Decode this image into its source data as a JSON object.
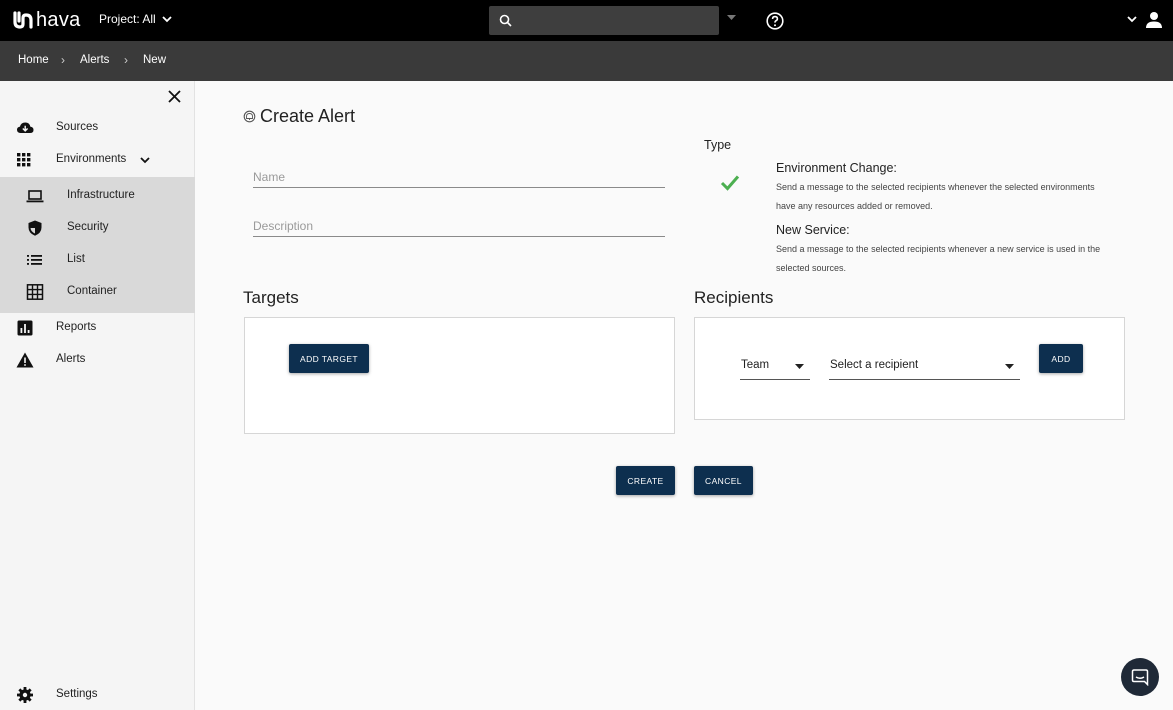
{
  "app": {
    "logo_text": "hava",
    "project_label": "Project: All"
  },
  "search": {
    "placeholder": ""
  },
  "breadcrumb": [
    "Home",
    "Alerts",
    "New"
  ],
  "sidebar": {
    "items": [
      {
        "label": "Sources",
        "icon": "cloud-download-icon"
      },
      {
        "label": "Environments",
        "icon": "grid-icon"
      }
    ],
    "sub_items": [
      {
        "label": "Infrastructure",
        "icon": "laptop-icon"
      },
      {
        "label": "Security",
        "icon": "shield-icon"
      },
      {
        "label": "List",
        "icon": "list-icon"
      },
      {
        "label": "Container",
        "icon": "table-grid-icon"
      }
    ],
    "lower_items": [
      {
        "label": "Reports",
        "icon": "bar-chart-icon"
      },
      {
        "label": "Alerts",
        "icon": "warning-icon"
      }
    ],
    "settings_label": "Settings"
  },
  "form": {
    "title": "Create Alert",
    "name_placeholder": "Name",
    "description_placeholder": "Description",
    "type_label": "Type",
    "types": [
      {
        "title": "Environment Change:",
        "desc": "Send a message to the selected recipients whenever the selected environments have any resources added or removed.",
        "selected": true
      },
      {
        "title": "New Service:",
        "desc": "Send a message to the selected recipients whenever a new service is used in the selected sources.",
        "selected": false
      }
    ],
    "targets_heading": "Targets",
    "add_target_label": "ADD TARGET",
    "recipients_heading": "Recipients",
    "recipient_kind": "Team",
    "recipient_placeholder": "Select a recipient",
    "add_label": "ADD",
    "create_label": "CREATE",
    "cancel_label": "CANCEL"
  },
  "colors": {
    "topbar": "#000000",
    "crumbbar": "#3a3a3a",
    "button": "#0d2f4f",
    "check": "#4caf50"
  }
}
